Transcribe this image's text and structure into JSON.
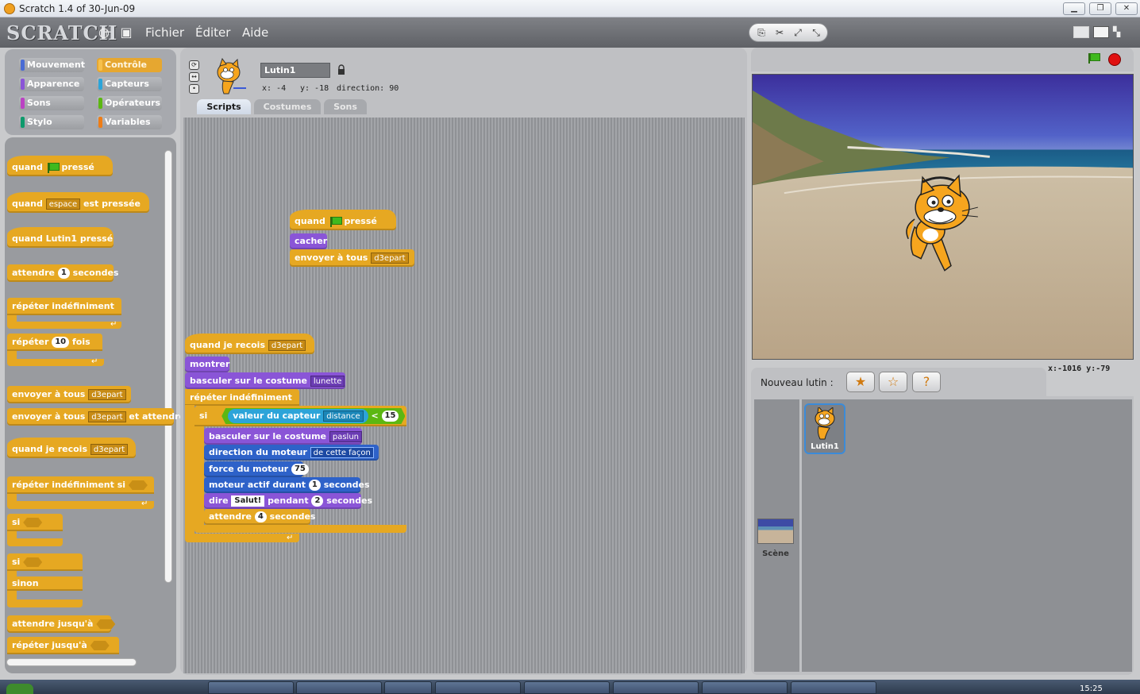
{
  "window": {
    "title": "Scratch 1.4 of 30-Jun-09"
  },
  "menubar": {
    "logo": "SCRATCH",
    "menus": [
      "Fichier",
      "Éditer",
      "Aide"
    ]
  },
  "categories": [
    {
      "label": "Mouvement",
      "color": "#4a6cd4"
    },
    {
      "label": "Contrôle",
      "color": "#e6a822"
    },
    {
      "label": "Apparence",
      "color": "#8a55d7"
    },
    {
      "label": "Capteurs",
      "color": "#2ca4d9"
    },
    {
      "label": "Sons",
      "color": "#bb42c3"
    },
    {
      "label": "Opérateurs",
      "color": "#5cb712"
    },
    {
      "label": "Stylo",
      "color": "#0e9a6c"
    },
    {
      "label": "Variables",
      "color": "#ee7d16"
    }
  ],
  "palette": {
    "quand": "quand",
    "presse": "pressé",
    "est_pressee": "est pressée",
    "espace": "espace",
    "quand_lutin": "quand Lutin1 pressé",
    "attendre": "attendre",
    "attendre_val": "1",
    "secondes": "secondes",
    "repeter_indef": "répéter indéfiniment",
    "repeter": "répéter",
    "repeter_val": "10",
    "fois": "fois",
    "envoyer_tous": "envoyer à tous",
    "d3epart": "d3epart",
    "et_attendre": "et attendre",
    "quand_recois": "quand je recois",
    "repeter_indef_si": "répéter indéfiniment si",
    "si": "si",
    "sinon": "sinon",
    "attendre_jusqua": "attendre jusqu'à",
    "repeter_jusqua": "répéter jusqu'à"
  },
  "sprite": {
    "name": "Lutin1",
    "x_label": "x: -4",
    "y_label": "y: -18",
    "dir_label": "direction: 90"
  },
  "tabs": [
    "Scripts",
    "Costumes",
    "Sons"
  ],
  "script1": {
    "quand": "quand",
    "presse": "pressé",
    "cacher": "cacher",
    "envoyer": "envoyer à tous",
    "msg": "d3epart"
  },
  "script2": {
    "quand_recois": "quand je recois",
    "msg": "d3epart",
    "montrer": "montrer",
    "basculer": "basculer sur le costume",
    "costume1": "lunette",
    "repeter": "répéter indéfiniment",
    "si": "si",
    "valeur_capteur": "valeur du capteur",
    "capteur": "distance",
    "lt": "<",
    "seuil": "15",
    "costume2": "paslun",
    "direction_moteur": "direction du moteur",
    "sens": "de cette façon",
    "force_moteur": "force du moteur",
    "force_val": "75",
    "moteur_actif": "moteur actif durant",
    "moteur_val": "1",
    "secondes": "secondes",
    "dire": "dire",
    "salut": "Salut!",
    "pendant": "pendant",
    "dire_val": "2",
    "attendre": "attendre",
    "attendre_val": "4"
  },
  "stage": {
    "mouse_x": "-1016",
    "mouse_y": "-79",
    "x_prefix": "x:",
    "y_prefix": "y:"
  },
  "new_sprite_label": "Nouveau lutin :",
  "sprites": [
    {
      "name": "Lutin1"
    }
  ],
  "scene_label": "Scène",
  "taskbar": {
    "clock": "15:25"
  }
}
